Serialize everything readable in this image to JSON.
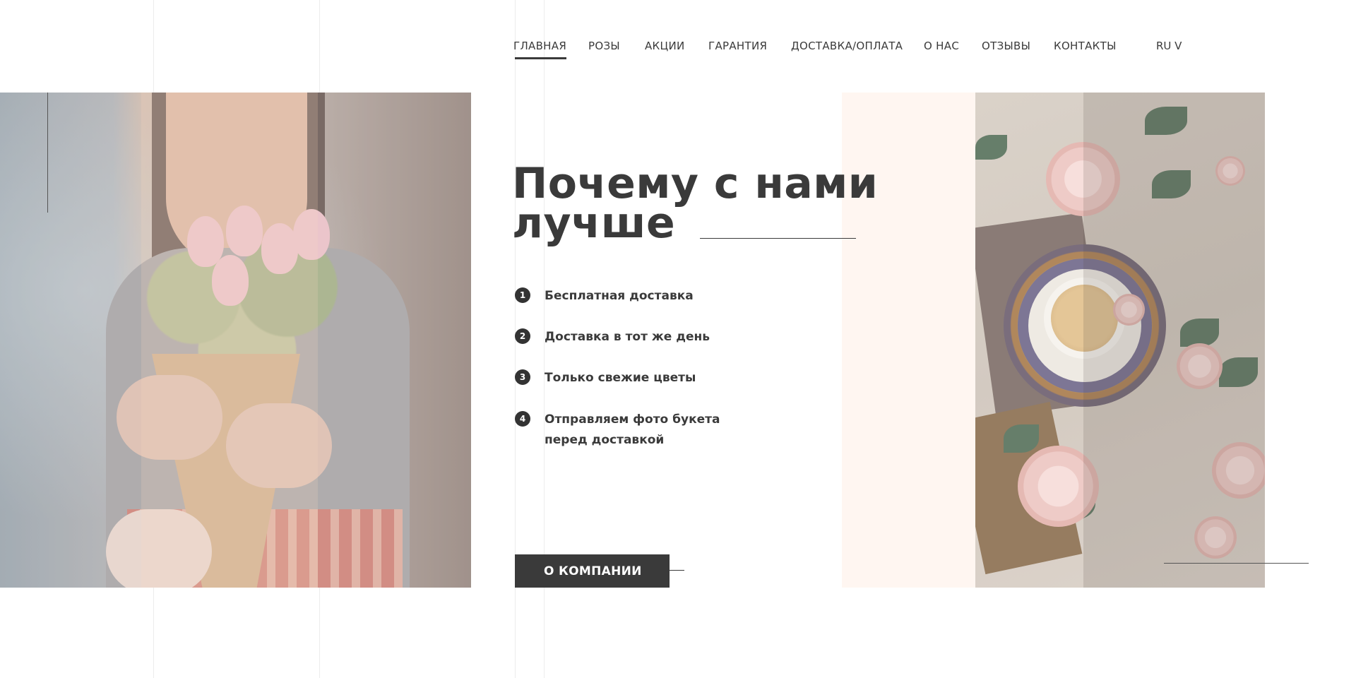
{
  "nav": {
    "items": [
      {
        "label": "ГЛАВНАЯ",
        "active": true
      },
      {
        "label": "РОЗЫ",
        "active": false
      },
      {
        "label": "АКЦИИ",
        "active": false
      },
      {
        "label": "ГАРАНТИЯ",
        "active": false
      },
      {
        "label": "ДОСТАВКА/ОПЛАТА",
        "active": false
      },
      {
        "label": "О НАС",
        "active": false
      },
      {
        "label": "ОТЗЫВЫ",
        "active": false
      },
      {
        "label": "КОНТАКТЫ",
        "active": false
      }
    ],
    "language": "RU V"
  },
  "hero": {
    "heading": "Почему с нами лучше",
    "features": [
      {
        "number": "1",
        "text": "Бесплатная доставка"
      },
      {
        "number": "2",
        "text": "Доставка в тот же день"
      },
      {
        "number": "3",
        "text": "Только свежие цветы"
      },
      {
        "number": "4",
        "text": "Отправляем фото букета\nперед  доставкой"
      }
    ],
    "button_label": "О КОМПАНИИ"
  },
  "colors": {
    "text": "#3a3a3a",
    "button_bg": "#3a3a3a",
    "peach": "#fff6f1"
  }
}
